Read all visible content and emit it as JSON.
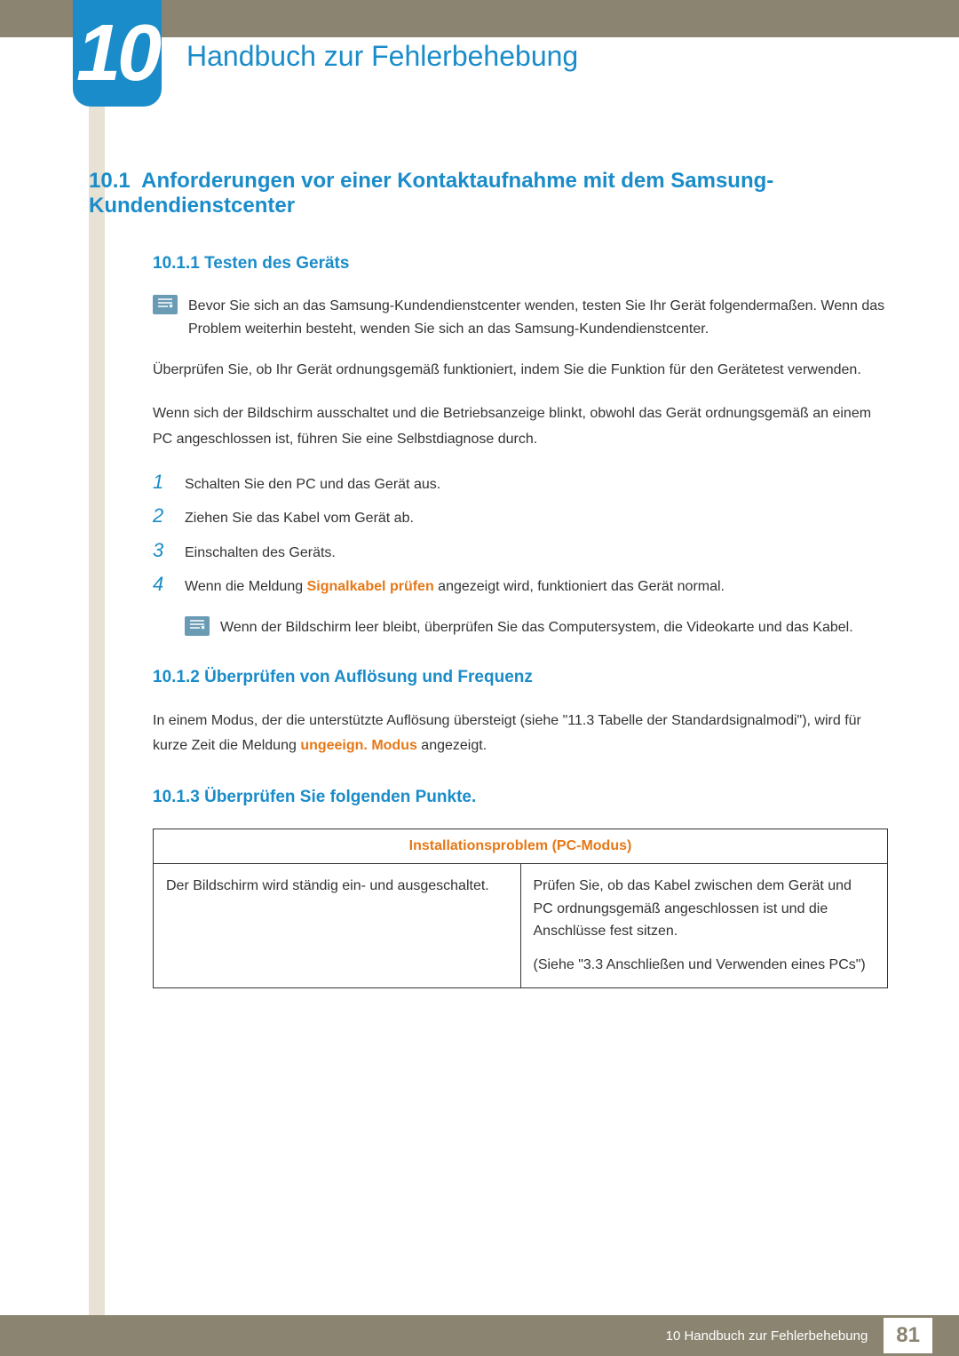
{
  "chapter": {
    "number": "10",
    "title": "Handbuch zur Fehlerbehebung"
  },
  "section": {
    "number": "10.1",
    "title": "Anforderungen vor einer Kontaktaufnahme mit dem Samsung-Kundendienstcenter"
  },
  "sub1": {
    "heading": "10.1.1  Testen des Geräts",
    "note": "Bevor Sie sich an das Samsung-Kundendienstcenter wenden, testen Sie Ihr Gerät folgendermaßen. Wenn das Problem weiterhin besteht, wenden Sie sich an das Samsung-Kundendienstcenter.",
    "p1": "Überprüfen Sie, ob Ihr Gerät ordnungsgemäß funktioniert, indem Sie die Funktion für den Gerätetest verwenden.",
    "p2": "Wenn sich der Bildschirm ausschaltet und die Betriebsanzeige blinkt, obwohl das Gerät ordnungsgemäß an einem PC angeschlossen ist, führen Sie eine Selbstdiagnose durch.",
    "steps": {
      "s1": "Schalten Sie den PC und das Gerät aus.",
      "s2": "Ziehen Sie das Kabel vom Gerät ab.",
      "s3": "Einschalten des Geräts.",
      "s4a": "Wenn die Meldung ",
      "s4b": "Signalkabel prüfen",
      "s4c": " angezeigt wird, funktioniert das Gerät normal."
    },
    "subnote": "Wenn der Bildschirm leer bleibt, überprüfen Sie das Computersystem, die Videokarte und das Kabel.",
    "nums": {
      "n1": "1",
      "n2": "2",
      "n3": "3",
      "n4": "4"
    }
  },
  "sub2": {
    "heading": "10.1.2  Überprüfen von Auflösung und Frequenz",
    "p1a": "In einem Modus, der die unterstützte Auflösung übersteigt (siehe \"11.3 Tabelle der Standardsignalmodi\"), wird für kurze Zeit die Meldung ",
    "p1b": "ungeeign. Modus",
    "p1c": " angezeigt."
  },
  "sub3": {
    "heading": "10.1.3  Überprüfen Sie folgenden Punkte.",
    "table": {
      "header": "Installationsproblem (PC-Modus)",
      "left": "Der Bildschirm wird ständig ein- und ausgeschaltet.",
      "right1": "Prüfen Sie, ob das Kabel zwischen dem Gerät und PC ordnungsgemäß angeschlossen ist und die Anschlüsse fest sitzen.",
      "right2": "(Siehe \"3.3 Anschließen und Verwenden eines PCs\")"
    }
  },
  "footer": {
    "text": "10 Handbuch zur Fehlerbehebung",
    "page": "81"
  }
}
